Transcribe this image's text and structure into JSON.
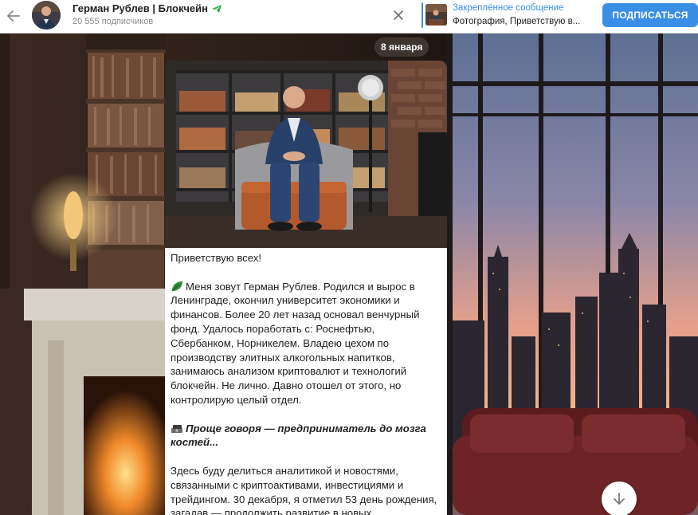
{
  "header": {
    "channel_title": "Герман Рублев | Блокчейн",
    "subscribers": "20 555 подписчиков",
    "pinned_title": "Закреплённое сообщение",
    "pinned_text": "Фотография, Приветствую в...",
    "subscribe_label": "ПОДПИСАТЬСЯ",
    "accent_color": "#3a8ee6"
  },
  "icons": {
    "back": "arrow-left-icon",
    "verified": "paper-plane-icon",
    "close": "close-icon",
    "scroll_down": "arrow-down-icon",
    "emoji_1": "leaf-emoji",
    "emoji_2": "money-emoji"
  },
  "feed": {
    "date": "8 января"
  },
  "post": {
    "greeting": "Приветствую всех!",
    "p1": "Меня зовут Герман Рублев. Родился и вырос в Ленинграде, окончил университет экономики и финансов. Более 20 лет назад основал венчурный фонд. Удалось поработать с: Роснефтью, Сбербанком, Норникелем. Владею цехом по производству элитных алкогольных напитков, занимаюсь анализом криптовалют и технологий блокчейн. Не лично. Давно отошел от этого, но контролирую целый отдел.",
    "p2": "Проще говоря — предприниматель до мозга костей...",
    "p3": "Здесь буду делиться аналитикой и новостями, связанными с криптоактивами, инвестициями и трейдингом. 30 декабря, я отметил 53 день рождения, загадав — продолжить развитие в новых"
  }
}
